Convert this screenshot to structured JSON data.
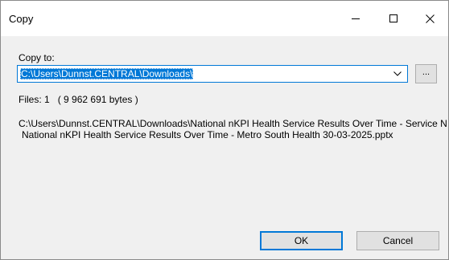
{
  "window": {
    "title": "Copy",
    "controls": {
      "minimize_icon": "minimize-icon",
      "maximize_icon": "maximize-icon",
      "close_icon": "close-icon"
    }
  },
  "copy_to": {
    "label": "Copy to:",
    "value": "C:\\Users\\Dunnst.CENTRAL\\Downloads\\",
    "dropdown_icon": "chevron-down-icon",
    "browse_label": "..."
  },
  "files_summary": {
    "label": "Files: 1",
    "size": "( 9 962 691 bytes )"
  },
  "file_paths": [
    "C:\\Users\\Dunnst.CENTRAL\\Downloads\\National nKPI Health Service Results Over Time - Service N",
    "National nKPI Health Service Results Over Time - Metro South Health 30-03-2025.pptx"
  ],
  "buttons": {
    "ok": "OK",
    "cancel": "Cancel"
  },
  "colors": {
    "accent": "#0078d7",
    "dialog_background": "#f0f0f0",
    "button_face": "#e1e1e1"
  }
}
